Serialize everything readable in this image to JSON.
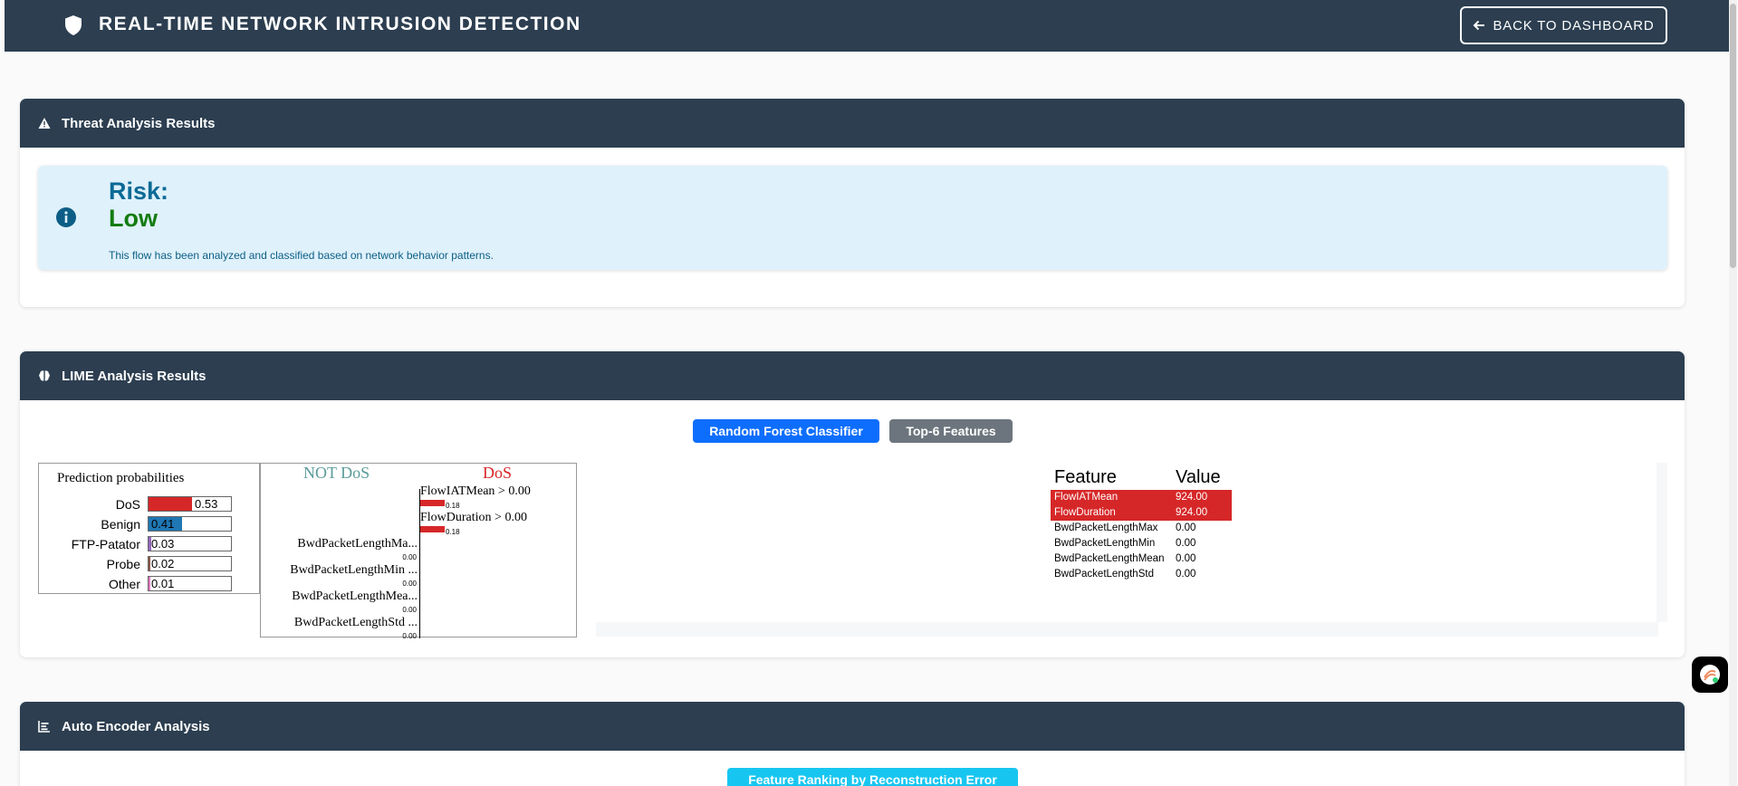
{
  "header": {
    "title": "REAL-TIME NETWORK INTRUSION DETECTION",
    "back_label": "BACK TO DASHBOARD"
  },
  "threat": {
    "title": "Threat Analysis Results",
    "risk_label": "Risk:",
    "risk_value": "Low",
    "description": "This flow has been analyzed and classified based on network behavior patterns."
  },
  "lime": {
    "title": "LIME Analysis Results",
    "btn_classifier": "Random Forest Classifier",
    "btn_features": "Top-6 Features",
    "prob_title": "Prediction probabilities",
    "probabilities": [
      {
        "label": "DoS",
        "value": "0.53",
        "fraction": 0.53,
        "color": "#d62728"
      },
      {
        "label": "Benign",
        "value": "0.41",
        "fraction": 0.41,
        "color": "#1f77b4"
      },
      {
        "label": "FTP-Patator",
        "value": "0.03",
        "fraction": 0.03,
        "color": "#9467bd"
      },
      {
        "label": "Probe",
        "value": "0.02",
        "fraction": 0.02,
        "color": "#8c564b"
      },
      {
        "label": "Other",
        "value": "0.01",
        "fraction": 0.01,
        "color": "#e377c2"
      }
    ],
    "explanation": {
      "negative_label": "NOT DoS",
      "positive_label": "DoS",
      "positive": [
        {
          "name": "FlowIATMean > 0.00",
          "weight": "0.18"
        },
        {
          "name": "FlowDuration > 0.00",
          "weight": "0.18"
        }
      ],
      "negative": [
        {
          "name": "BwdPacketLengthMa...",
          "weight": "0.00"
        },
        {
          "name": "BwdPacketLengthMin ...",
          "weight": "0.00"
        },
        {
          "name": "BwdPacketLengthMea...",
          "weight": "0.00"
        },
        {
          "name": "BwdPacketLengthStd ...",
          "weight": "0.00"
        }
      ]
    },
    "feature_table": {
      "col_feature": "Feature",
      "col_value": "Value",
      "rows": [
        {
          "feature": "FlowIATMean",
          "value": "924.00",
          "highlight": true
        },
        {
          "feature": "FlowDuration",
          "value": "924.00",
          "highlight": true
        },
        {
          "feature": "BwdPacketLengthMax",
          "value": "0.00",
          "highlight": false
        },
        {
          "feature": "BwdPacketLengthMin",
          "value": "0.00",
          "highlight": false
        },
        {
          "feature": "BwdPacketLengthMean",
          "value": "0.00",
          "highlight": false
        },
        {
          "feature": "BwdPacketLengthStd",
          "value": "0.00",
          "highlight": false
        }
      ]
    }
  },
  "autoencoder": {
    "title": "Auto Encoder Analysis",
    "btn_ranking": "Feature Ranking by Reconstruction Error"
  },
  "icons": {
    "logo": "shield-icon",
    "back": "arrow-left-icon",
    "threat": "warning-icon",
    "info": "info-icon",
    "lime": "brain-icon",
    "autoencoder": "bar-chart-icon",
    "chat": "chat-widget-icon"
  }
}
